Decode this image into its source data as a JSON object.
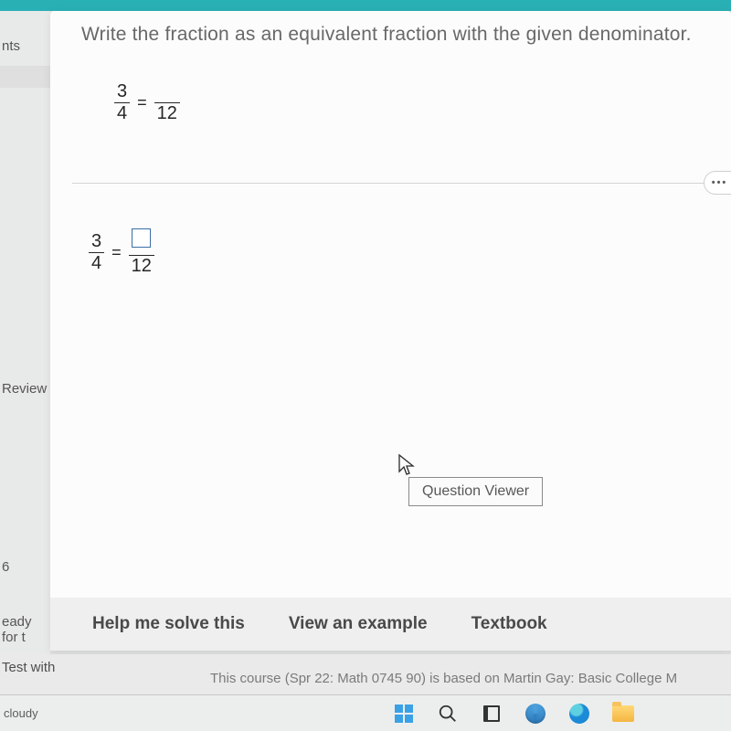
{
  "sidebar": {
    "item1": "nts",
    "item2": "Review",
    "item3": "6",
    "item4": "eady for t"
  },
  "question": {
    "prompt": "Write the fraction as an equivalent fraction with the given denominator.",
    "given": {
      "num": "3",
      "den": "4",
      "equals": "=",
      "target_den": "12"
    },
    "answer_row": {
      "num": "3",
      "den": "4",
      "equals": "=",
      "target_den": "12"
    },
    "more": "•••",
    "tooltip": "Question Viewer"
  },
  "actions": {
    "help": "Help me solve this",
    "example": "View an example",
    "textbook": "Textbook"
  },
  "below": {
    "testwith": "Test with",
    "course": "This course (Spr 22: Math 0745 90) is based on Martin Gay: Basic College M"
  },
  "taskbar": {
    "weather": "cloudy"
  }
}
